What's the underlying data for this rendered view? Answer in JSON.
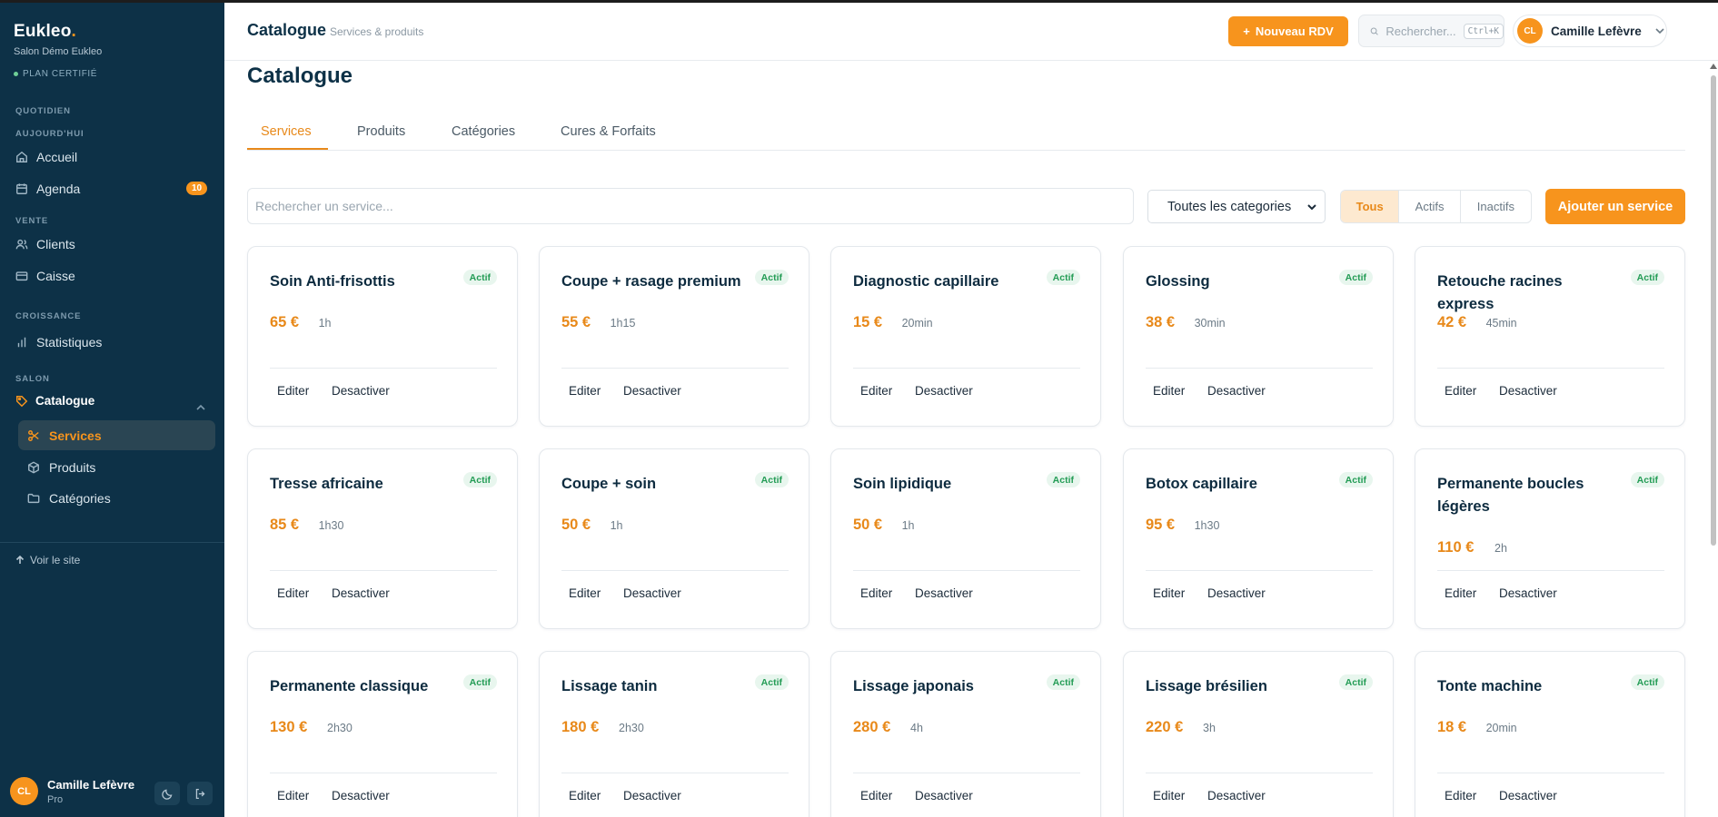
{
  "sidebar": {
    "brand": "Eukleo",
    "brand_dot": ".",
    "salon": "Salon Démo Eukleo",
    "plan": "PLAN CERTIFIÉ",
    "sections": {
      "quotidien": "QUOTIDIEN",
      "aujourdhui": "AUJOURD'HUI",
      "vente": "VENTE",
      "croissance": "CROISSANCE",
      "salon": "SALON"
    },
    "items": {
      "accueil": "Accueil",
      "agenda": "Agenda",
      "agenda_badge": "10",
      "clients": "Clients",
      "caisse": "Caisse",
      "statistiques": "Statistiques",
      "catalogue": "Catalogue",
      "services": "Services",
      "produits": "Produits",
      "categories": "Catégories"
    },
    "visit_site": "Voir le site",
    "user": {
      "initials": "CL",
      "name": "Camille Lefèvre",
      "role": "Pro"
    }
  },
  "header": {
    "title": "Catalogue",
    "subtitle": "Services & produits",
    "new_rdv": "Nouveau RDV",
    "search_placeholder": "Rechercher...",
    "search_shortcut": "Ctrl+K",
    "user_initials": "CL",
    "user_name": "Camille Lefèvre"
  },
  "main": {
    "page_title": "Catalogue",
    "tabs": [
      "Services",
      "Produits",
      "Catégories",
      "Cures & Forfaits"
    ],
    "search_placeholder": "Rechercher un service...",
    "category_filter": "Toutes les categories",
    "status_filters": [
      "Tous",
      "Actifs",
      "Inactifs"
    ],
    "add_button": "Ajouter un service",
    "edit_label": "Editer",
    "deactivate_label": "Desactiver",
    "services": [
      {
        "name": "Soin Anti-frisottis",
        "status": "Actif",
        "price": "65 €",
        "duration": "1h"
      },
      {
        "name": "Coupe + rasage premium",
        "status": "Actif",
        "price": "55 €",
        "duration": "1h15"
      },
      {
        "name": "Diagnostic capillaire",
        "status": "Actif",
        "price": "15 €",
        "duration": "20min"
      },
      {
        "name": "Glossing",
        "status": "Actif",
        "price": "38 €",
        "duration": "30min"
      },
      {
        "name": "Retouche racines express",
        "status": "Actif",
        "price": "42 €",
        "duration": "45min"
      },
      {
        "name": "Tresse africaine",
        "status": "Actif",
        "price": "85 €",
        "duration": "1h30"
      },
      {
        "name": "Coupe + soin",
        "status": "Actif",
        "price": "50 €",
        "duration": "1h"
      },
      {
        "name": "Soin lipidique",
        "status": "Actif",
        "price": "50 €",
        "duration": "1h"
      },
      {
        "name": "Botox capillaire",
        "status": "Actif",
        "price": "95 €",
        "duration": "1h30"
      },
      {
        "name": "Permanente boucles légères",
        "status": "Actif",
        "price": "110 €",
        "duration": "2h"
      },
      {
        "name": "Permanente classique",
        "status": "Actif",
        "price": "130 €",
        "duration": "2h30"
      },
      {
        "name": "Lissage tanin",
        "status": "Actif",
        "price": "180 €",
        "duration": "2h30"
      },
      {
        "name": "Lissage japonais",
        "status": "Actif",
        "price": "280 €",
        "duration": "4h"
      },
      {
        "name": "Lissage brésilien",
        "status": "Actif",
        "price": "220 €",
        "duration": "3h"
      },
      {
        "name": "Tonte machine",
        "status": "Actif",
        "price": "18 €",
        "duration": "20min"
      }
    ]
  },
  "colors": {
    "accent": "#f7941d",
    "sidebar": "#0d3147",
    "status_green": "#239c55"
  }
}
